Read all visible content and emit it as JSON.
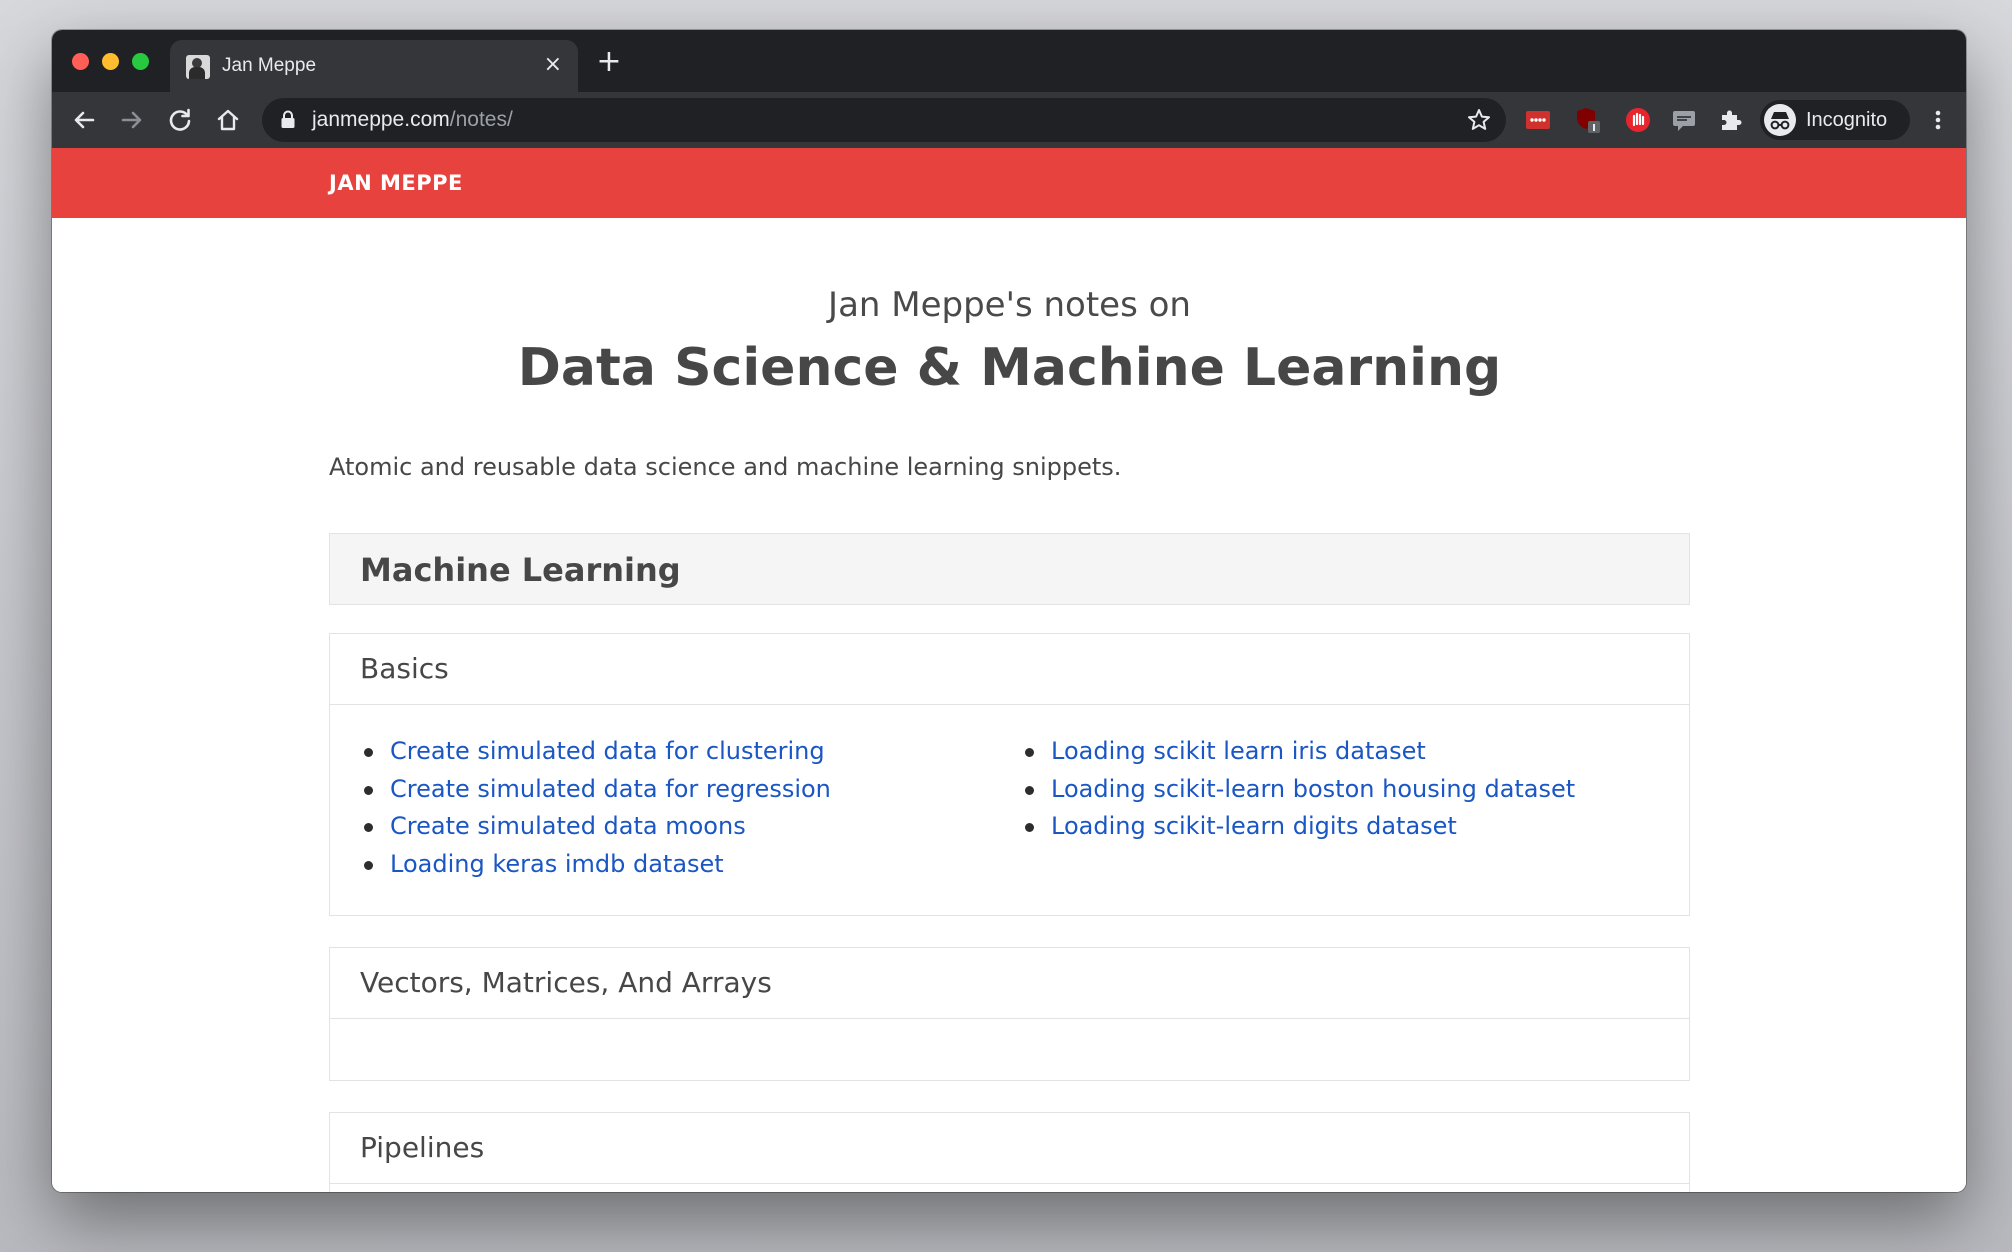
{
  "browser": {
    "tab": {
      "title": "Jan Meppe",
      "close_glyph": "×",
      "favicon": "portrait-favicon"
    },
    "new_tab_glyph": "+",
    "address": {
      "host": "janmeppe.com",
      "path": "/notes/"
    },
    "profile": {
      "label": "Incognito"
    },
    "colors": {
      "tabstrip": "#202124",
      "toolbar": "#35363a",
      "omnibox": "#202124"
    }
  },
  "site": {
    "brand": "JAN MEPPE",
    "accent_color": "#e8423f",
    "link_color": "#1a56c4"
  },
  "page": {
    "kicker": "Jan Meppe's notes on",
    "title": "Data Science & Machine Learning",
    "intro": "Atomic and reusable data science and machine learning snippets."
  },
  "section": {
    "title": "Machine Learning",
    "cards": [
      {
        "title": "Basics",
        "columns": [
          [
            "Create simulated data for clustering",
            "Create simulated data for regression",
            "Create simulated data moons",
            "Loading keras imdb dataset"
          ],
          [
            "Loading scikit learn iris dataset",
            "Loading scikit-learn boston housing dataset",
            "Loading scikit-learn digits dataset"
          ]
        ]
      },
      {
        "title": "Vectors, Matrices, And Arrays"
      },
      {
        "title": "Pipelines"
      }
    ]
  }
}
